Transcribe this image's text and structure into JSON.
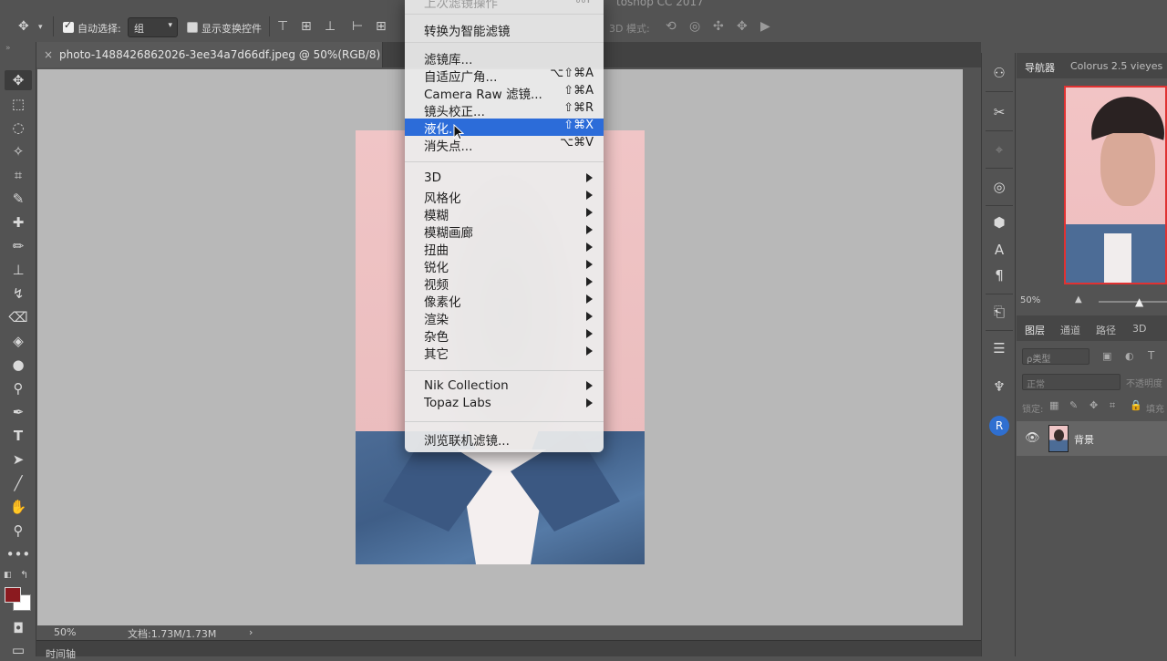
{
  "app": {
    "title": "toshop CC 2017"
  },
  "options_bar": {
    "auto_select_label": "自动选择:",
    "auto_select_checked": true,
    "auto_select_value": "组",
    "show_transform_label": "显示变换控件",
    "show_transform_checked": false,
    "mode_3d_label": "3D 模式:"
  },
  "document_tab": {
    "close": "×",
    "name": "photo-1488426862026-3ee34a7d66df.jpeg @ 50%(RGB/8)"
  },
  "filter_menu": {
    "last_filter": {
      "label": "上次滤镜操作",
      "shortcut": "⌘F"
    },
    "convert_smart": "转换为智能滤镜",
    "group1": [
      {
        "label": "滤镜库...",
        "shortcut": ""
      },
      {
        "label": "自适应广角...",
        "shortcut": "⌥⇧⌘A"
      },
      {
        "label": "Camera Raw 滤镜...",
        "shortcut": "⇧⌘A"
      },
      {
        "label": "镜头校正...",
        "shortcut": "⇧⌘R"
      },
      {
        "label": "液化...",
        "shortcut": "⇧⌘X"
      },
      {
        "label": "消失点...",
        "shortcut": "⌥⌘V"
      }
    ],
    "selected_index": 4,
    "group2": [
      "3D",
      "风格化",
      "模糊",
      "模糊画廊",
      "扭曲",
      "锐化",
      "视频",
      "像素化",
      "渲染",
      "杂色",
      "其它"
    ],
    "group3": [
      "Nik Collection",
      "Topaz Labs"
    ],
    "browse": "浏览联机滤镜..."
  },
  "status_bar": {
    "zoom": "50%",
    "doc_info": "文档:1.73M/1.73M",
    "arrow": "›"
  },
  "timeline": {
    "label": "时间轴"
  },
  "navigator": {
    "tab_label": "导航器",
    "colorus_label": "Colorus 2.5 vieyes",
    "zoom": "50%"
  },
  "layers_panel": {
    "tabs": [
      "图层",
      "通道",
      "路径",
      "3D"
    ],
    "search_placeholder": "ρ类型",
    "blend_mode": "正常",
    "opacity_label": "不透明度",
    "lock_label": "锁定:",
    "fill_label": "填充",
    "layer_name": "背景"
  },
  "colors": {
    "foreground": "#8b1a1f",
    "background": "#ffffff",
    "menu_highlight": "#2c6cd9"
  }
}
